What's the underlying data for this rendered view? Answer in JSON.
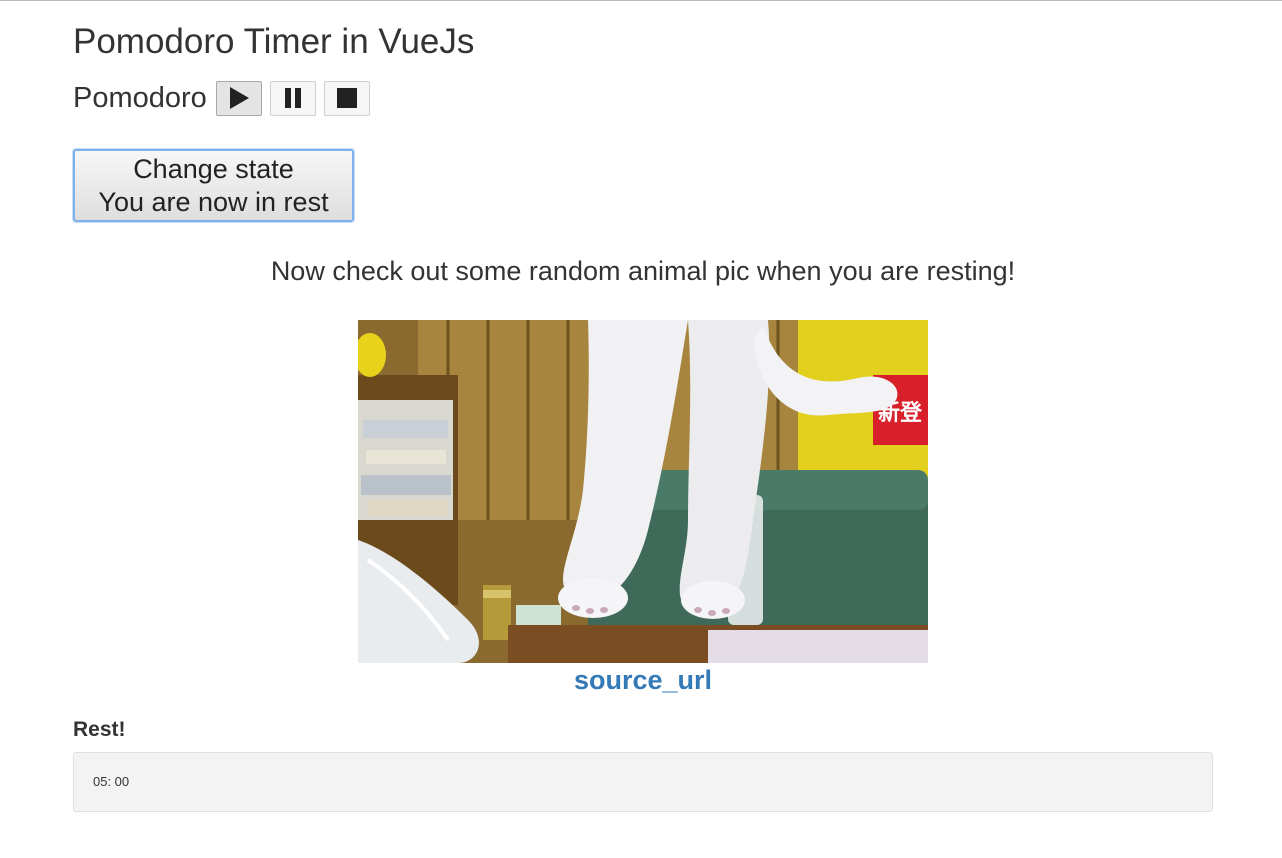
{
  "page": {
    "title": "Pomodoro Timer in VueJs"
  },
  "timer": {
    "label": "Pomodoro",
    "controls": [
      {
        "icon": "play-icon"
      },
      {
        "icon": "pause-icon"
      },
      {
        "icon": "stop-icon"
      }
    ]
  },
  "state_button": {
    "line1": "Change state",
    "line2": "You are now in rest"
  },
  "rest": {
    "heading": "Now check out some random animal pic when you are resting!",
    "image_alt": "random animal picture of a cat",
    "source_link": "source_url"
  },
  "status": {
    "label": "Rest!",
    "time": "05: 00"
  },
  "colors": {
    "link": "#337ab7",
    "focus_border": "#7fb2ea",
    "text": "#333333",
    "well_bg": "#f3f3f3"
  }
}
